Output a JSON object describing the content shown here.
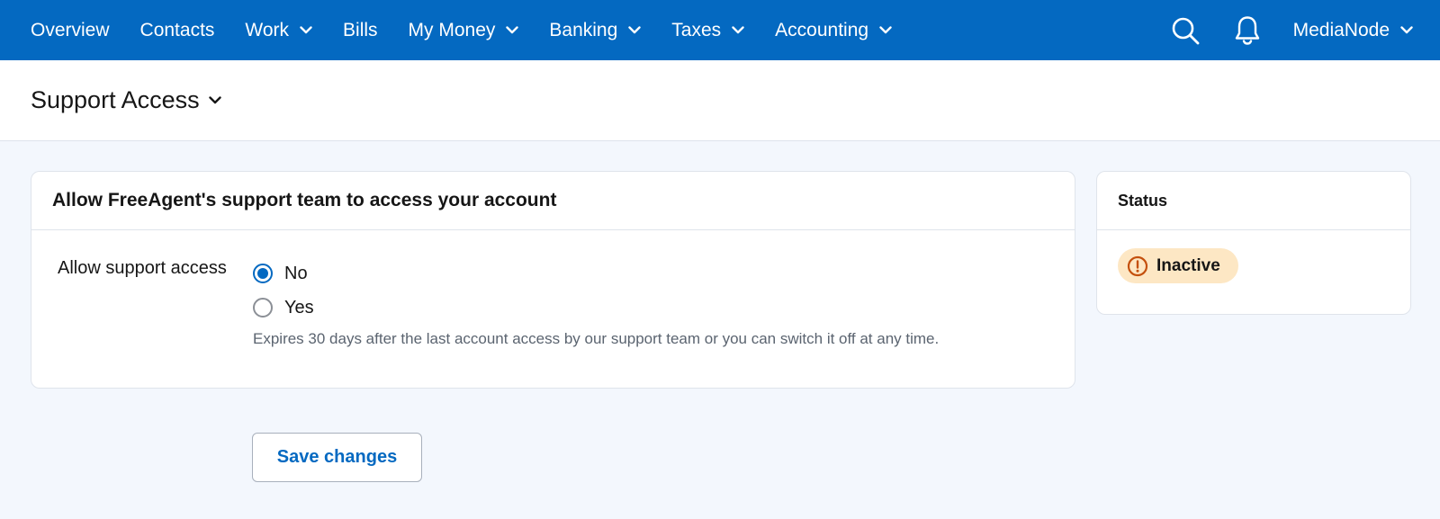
{
  "nav": {
    "items": [
      {
        "label": "Overview",
        "has_menu": false
      },
      {
        "label": "Contacts",
        "has_menu": false
      },
      {
        "label": "Work",
        "has_menu": true
      },
      {
        "label": "Bills",
        "has_menu": false
      },
      {
        "label": "My Money",
        "has_menu": true
      },
      {
        "label": "Banking",
        "has_menu": true
      },
      {
        "label": "Taxes",
        "has_menu": true
      },
      {
        "label": "Accounting",
        "has_menu": true
      }
    ],
    "account_name": "MediaNode",
    "search_icon": "search-icon",
    "notifications_icon": "bell-icon"
  },
  "page": {
    "title": "Support Access"
  },
  "support_card": {
    "heading": "Allow FreeAgent's support team to access your account",
    "field_label": "Allow support access",
    "options": [
      {
        "label": "No",
        "selected": true
      },
      {
        "label": "Yes",
        "selected": false
      }
    ],
    "hint": "Expires 30 days after the last account access by our support team or you can switch it off at any time."
  },
  "status_card": {
    "heading": "Status",
    "badge_label": "Inactive",
    "badge_color": "#fde7c4",
    "badge_icon": "warning-icon",
    "badge_icon_color": "#c4500d"
  },
  "actions": {
    "save_label": "Save changes"
  },
  "colors": {
    "brand": "#0469c1",
    "background": "#f3f7fd"
  }
}
